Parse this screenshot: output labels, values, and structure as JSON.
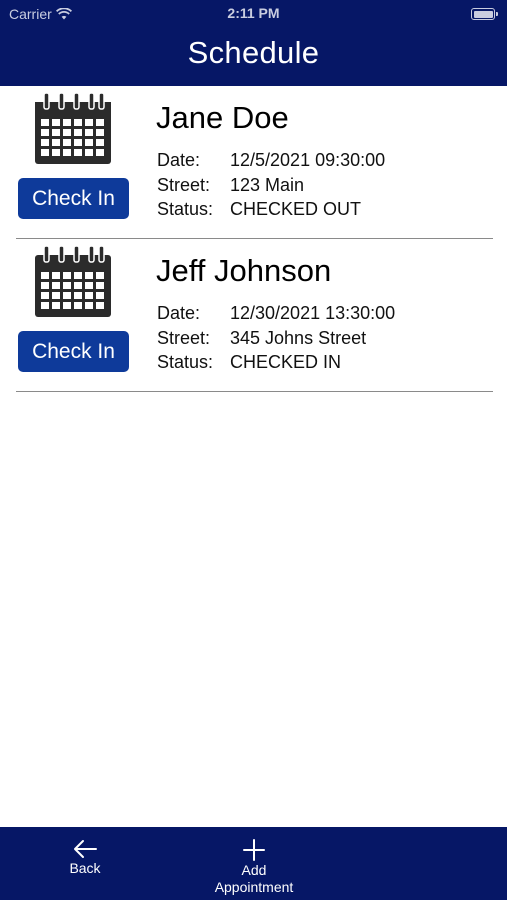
{
  "status_bar": {
    "carrier": "Carrier",
    "time": "2:11 PM"
  },
  "header": {
    "title": "Schedule"
  },
  "appointments": [
    {
      "name": "Jane Doe",
      "button_label": "Check In",
      "date_label": "Date:",
      "date": "12/5/2021 09:30:00",
      "street_label": "Street:",
      "street": "123 Main",
      "status_label": "Status:",
      "status": "CHECKED OUT"
    },
    {
      "name": "Jeff Johnson",
      "button_label": "Check In",
      "date_label": "Date:",
      "date": "12/30/2021 13:30:00",
      "street_label": "Street:",
      "street": "345 Johns Street",
      "status_label": "Status:",
      "status": "CHECKED IN"
    }
  ],
  "tab_bar": {
    "back_label": "Back",
    "add_label_line1": "Add",
    "add_label_line2": "Appointment"
  },
  "colors": {
    "nav": "#061766",
    "button": "#0e3a9a"
  }
}
